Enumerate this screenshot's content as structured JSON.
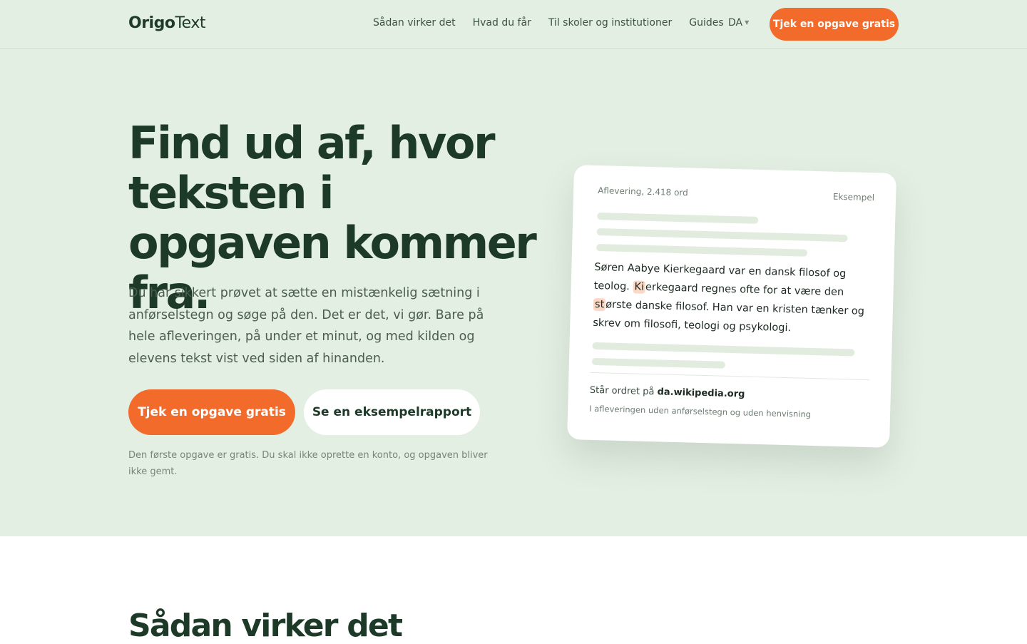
{
  "nav": {
    "logo_bold": "Origo",
    "logo_light": "Text",
    "links": [
      "Sådan virker det",
      "Hvad du får",
      "Til skoler og institutioner",
      "Guides"
    ],
    "language": "DA",
    "cta": "Tjek en opgave gratis"
  },
  "hero": {
    "headline": "Find ud af, hvor teksten i opgaven kommer fra.",
    "lead": "Du har sikkert prøvet at sætte en mistænkelig sætning i anførselstegn og søge på den. Det er det, vi gør. Bare på hele afleveringen, på under et minut, og med kilden og elevens tekst vist ved siden af hinanden.",
    "primary_button": "Tjek en opgave gratis",
    "secondary_button": "Se en eksempelrapport",
    "fineprint": "Den første opgave er gratis. Du skal ikke oprette en konto, og opgaven bliver ikke gemt."
  },
  "example_card": {
    "meta": "Aflevering, 2.418 ord",
    "tag": "Eksempel",
    "text_part1": "Søren Aabye Kierkegaard var en dansk filosof og teolog.",
    "text_hl1": "Ki",
    "text_part2": "erkegaard regnes ofte for at være den",
    "text_hl2": "st",
    "text_part3": "ørste danske filosof.",
    "text_part4": "Han var en kristen tænker og skrev om filosofi, teologi og psykologi.",
    "source_prefix": "Står ordret på",
    "source_domain": "da.wikipedia.org",
    "note": "I afleveringen uden anførselstegn og uden henvisning"
  },
  "section": {
    "title": "Sådan virker det"
  },
  "colors": {
    "accent": "#f26b2b",
    "hero_bg": "#e4efe3",
    "heading": "#1d3a28"
  }
}
